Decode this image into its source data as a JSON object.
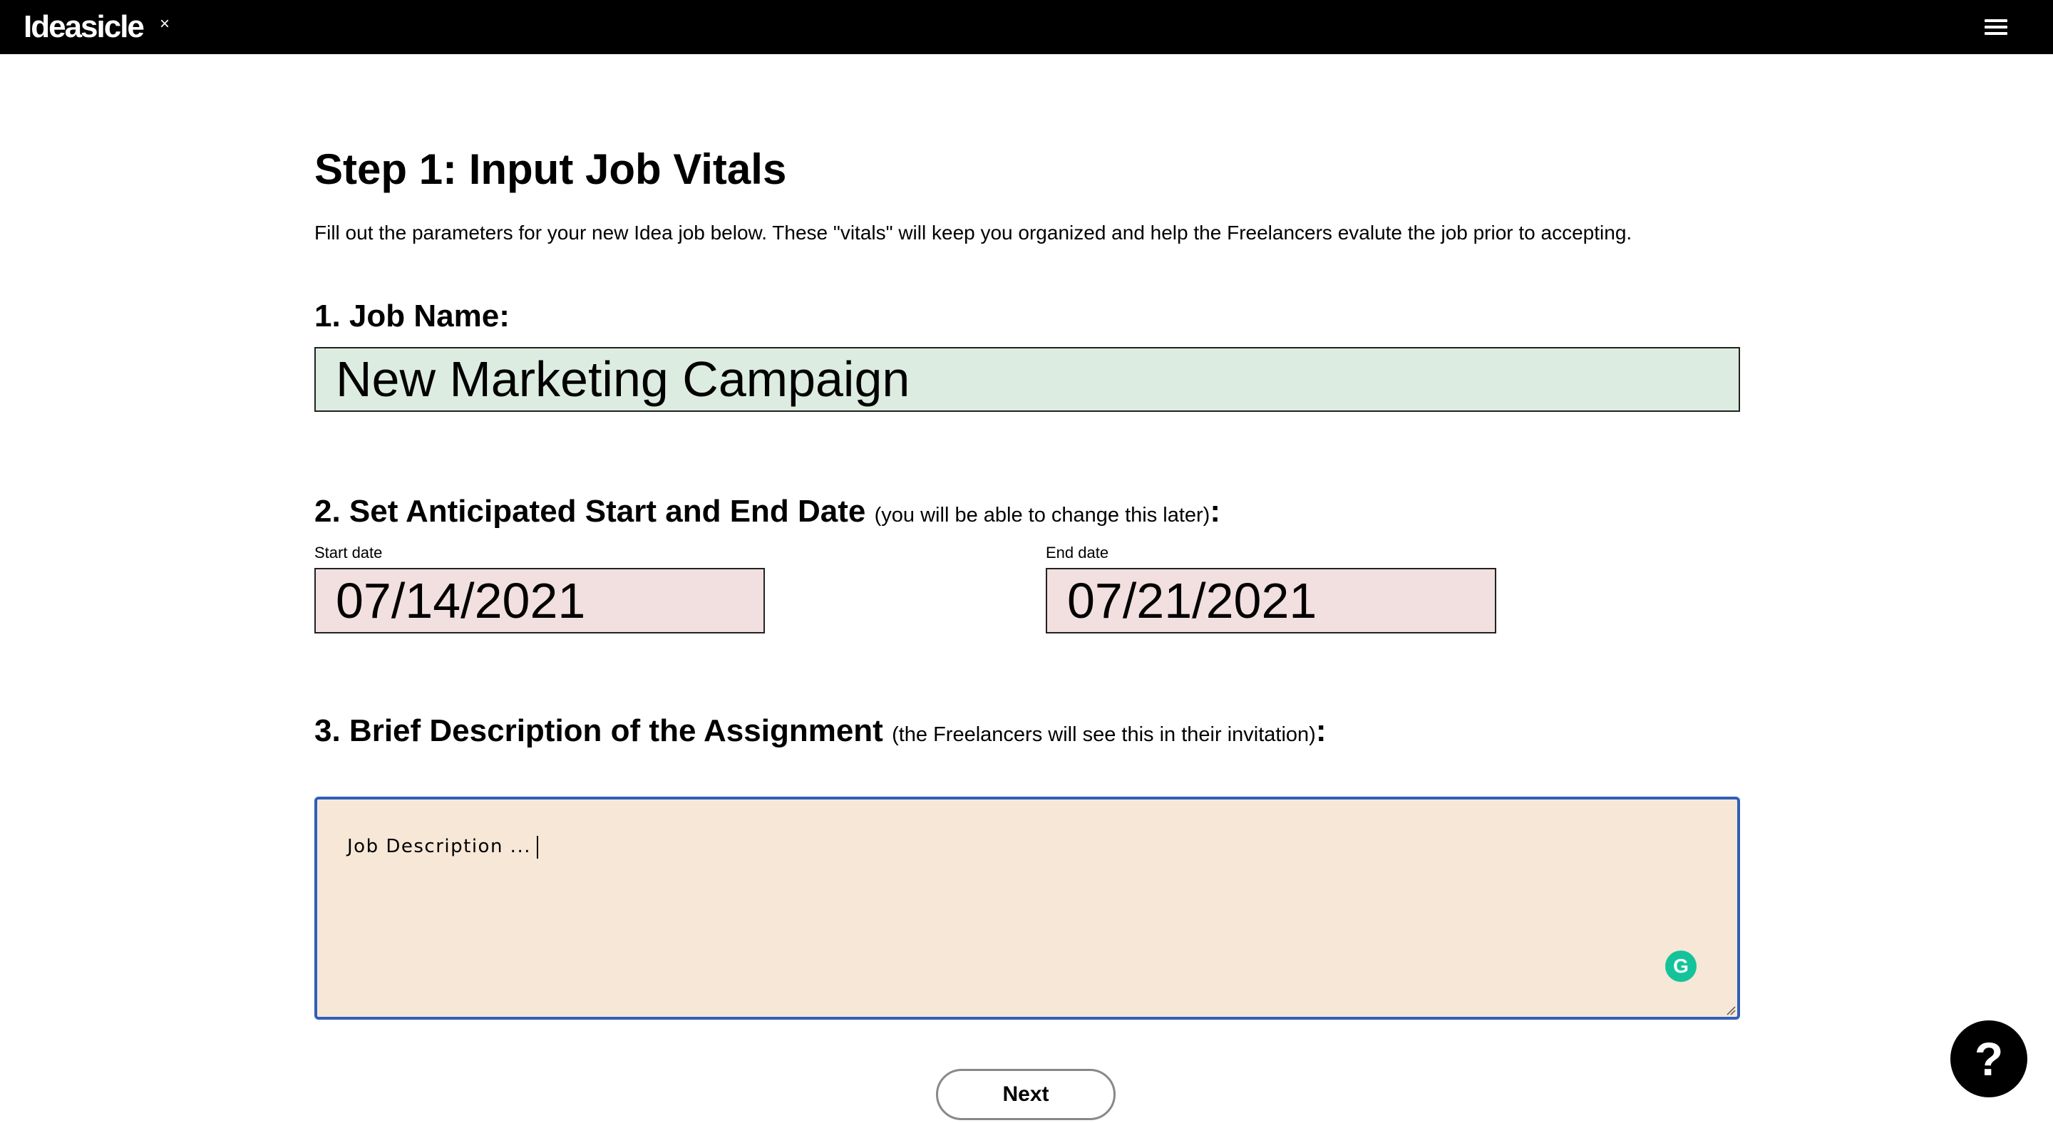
{
  "header": {
    "brand": "Ideasicle",
    "close_glyph": "×",
    "menu_icon": "hamburger-menu-icon",
    "background": "#000000"
  },
  "page": {
    "title": "Step 1: Input Job Vitals",
    "intro": "Fill out the parameters for your new Idea job below. These \"vitals\" will keep you organized and help the Freelancers evalute the job prior to accepting."
  },
  "job_name": {
    "heading": "1. Job Name:",
    "value": "New Marketing Campaign",
    "background": "#dcece0"
  },
  "dates": {
    "heading": "2. Set Anticipated Start and End Date",
    "note": "(you will be able to change this later)",
    "colon": ":",
    "start_label": "Start date",
    "start_value": "07/14/2021",
    "end_label": "End date",
    "end_value": "07/21/2021",
    "background": "#f2dfe0"
  },
  "description": {
    "heading": "3. Brief Description of the Assignment",
    "note": "(the Freelancers will see this in their invitation)",
    "colon": ":",
    "placeholder": "Job Description ...",
    "background": "#f6e7d7",
    "border": "#2f5fb8",
    "grammar_icon": "grammarly-icon",
    "grammar_glyph": "G"
  },
  "actions": {
    "next_label": "Next",
    "help_glyph": "?",
    "help_icon": "help-question-icon"
  }
}
